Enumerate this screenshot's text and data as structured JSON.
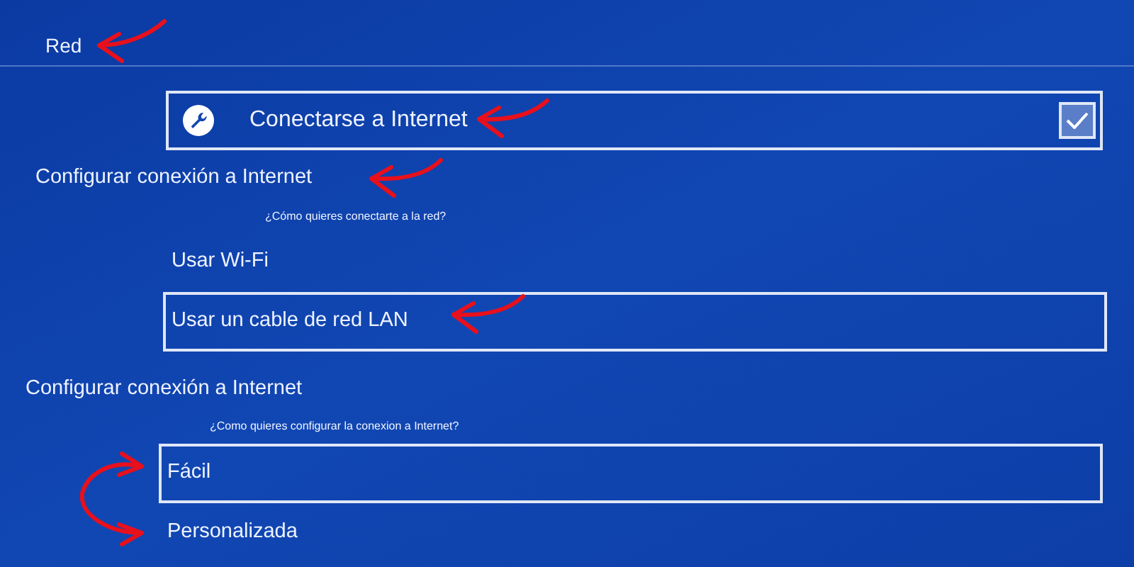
{
  "header": {
    "title": "Red"
  },
  "top_item": {
    "label": "Conectarse a Internet",
    "checked": true,
    "selected": true
  },
  "sections": [
    {
      "title": "Configurar conexión a Internet",
      "prompt": "¿Cómo quieres conectarte a la red?",
      "options": [
        {
          "label": "Usar Wi-Fi",
          "selected": false
        },
        {
          "label": "Usar un cable de red LAN",
          "selected": true
        }
      ]
    },
    {
      "title": "Configurar conexión a Internet",
      "prompt": "¿Como quieres configurar la conexion a Internet?",
      "options": [
        {
          "label": "Fácil",
          "selected": true
        },
        {
          "label": "Personalizada",
          "selected": false
        }
      ]
    }
  ]
}
